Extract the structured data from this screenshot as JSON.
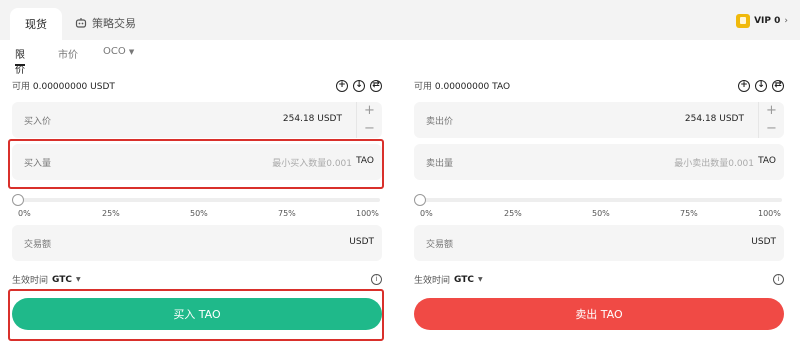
{
  "tabs": {
    "spot": "现货",
    "strategy": "策略交易"
  },
  "vip": "VIP 0",
  "order_types": {
    "limit": "限价",
    "market": "市价",
    "oco": "OCO"
  },
  "buy": {
    "avail_label": "可用",
    "avail_amount": "0.00000000 USDT",
    "price_label": "买入价",
    "price_value": "254.18 USDT",
    "qty_label": "买入量",
    "qty_placeholder": "最小买入数量0.001",
    "qty_unit": "TAO",
    "amount_label": "交易额",
    "amount_unit": "USDT",
    "eff_label": "生效时间",
    "eff_value": "GTC",
    "button": "买入 TAO"
  },
  "sell": {
    "avail_label": "可用",
    "avail_amount": "0.00000000 TAO",
    "price_label": "卖出价",
    "price_value": "254.18 USDT",
    "qty_label": "卖出量",
    "qty_placeholder": "最小卖出数量0.001",
    "qty_unit": "TAO",
    "amount_label": "交易额",
    "amount_unit": "USDT",
    "eff_label": "生效时间",
    "eff_value": "GTC",
    "button": "卖出 TAO"
  },
  "slider_ticks": [
    "0%",
    "25%",
    "50%",
    "75%",
    "100%"
  ],
  "slider_level": 0,
  "icons": [
    "plus-circle-icon",
    "download-circle-icon",
    "transfer-circle-icon",
    "info-icon",
    "robot-icon",
    "vip-badge-icon"
  ],
  "colors": {
    "buy": "#1fb98a",
    "sell": "#f04a45",
    "highlight": "#d9302b",
    "vip": "#f0b90b"
  }
}
